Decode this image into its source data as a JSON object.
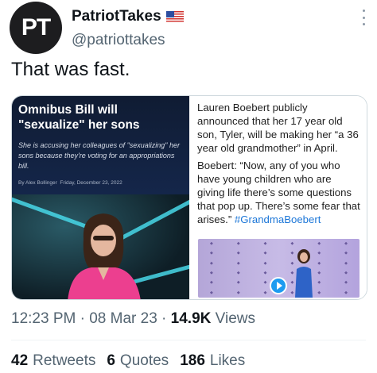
{
  "author": {
    "avatar_text": "PT",
    "display_name": "PatriotTakes",
    "handle": "@patriottakes"
  },
  "tweet": {
    "text": "That was fast."
  },
  "media": {
    "left_card": {
      "headline": "Omnibus Bill will \"sexualize\" her sons",
      "subhead": "She is accusing her colleagues of \"sexualizing\" her sons because they're voting for an appropriations bill.",
      "byline_author": "By Alex Bollinger",
      "byline_date": "Friday, December 23, 2022"
    },
    "right_card": {
      "paragraph1": "Lauren Boebert publicly announced that her 17 year old son, Tyler, will be making her “a 36 year old grandmother” in April.",
      "paragraph2": "Boebert: “Now, any of you who have young children who are giving life there’s some questions that pop up. There’s some fear that arises.” ",
      "hashtag": "#GrandmaBoebert"
    }
  },
  "meta": {
    "time": "12:23 PM",
    "separator1": "·",
    "date": "08 Mar 23",
    "separator2": "·",
    "views_count": "14.9K",
    "views_label": "Views"
  },
  "stats": {
    "retweets_count": "42",
    "retweets_label": "Retweets",
    "quotes_count": "6",
    "quotes_label": "Quotes",
    "likes_count": "186",
    "likes_label": "Likes"
  },
  "colors": {
    "text": "#0f1419",
    "secondary": "#536471",
    "link": "#1d77d8",
    "news_bg": "#14264a"
  },
  "icons": {
    "flag": "us-flag-icon",
    "more": "more-options-icon",
    "play": "play-icon"
  }
}
